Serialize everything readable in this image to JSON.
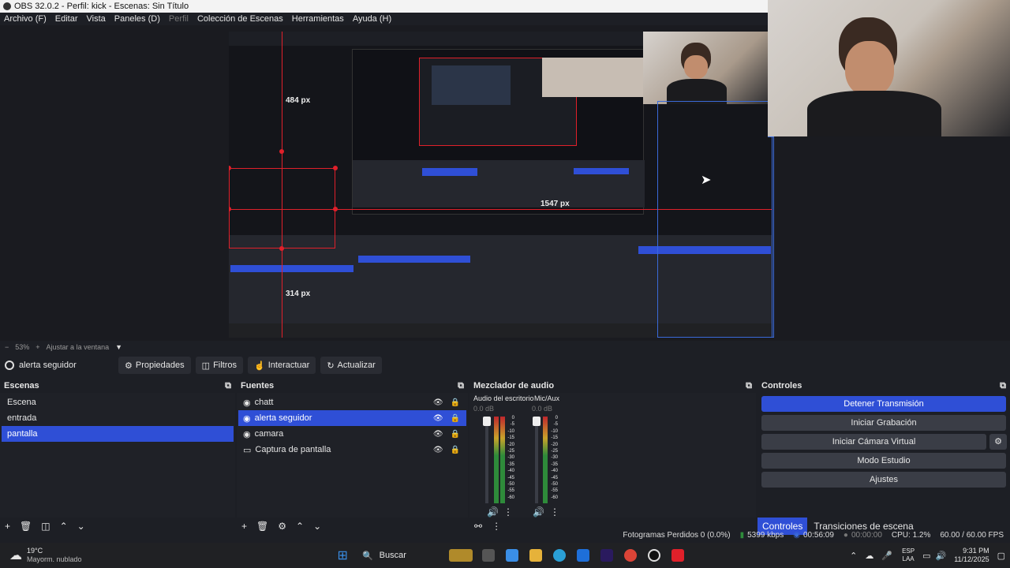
{
  "window": {
    "title": "OBS 32.0.2 - Perfil: kick - Escenas: Sin Título"
  },
  "menu": [
    "Archivo (F)",
    "Editar",
    "Vista",
    "Paneles (D)",
    "Perfil",
    "Colección de Escenas",
    "Herramientas",
    "Ayuda (H)"
  ],
  "preview": {
    "label_484": "484 px",
    "label_314": "314 px",
    "label_1547": "1547 px"
  },
  "zoom": {
    "minus": "−",
    "value": "53%",
    "plus": "+",
    "fit": "Ajustar a la ventana",
    "arrow": "▼"
  },
  "source_toolbar": {
    "selected_source": "alerta seguidor",
    "properties": "Propiedades",
    "filters": "Filtros",
    "interact": "Interactuar",
    "refresh": "Actualizar"
  },
  "scenes": {
    "title": "Escenas",
    "items": [
      "Escena",
      "entrada",
      "pantalla"
    ],
    "selected": "pantalla"
  },
  "sources": {
    "title": "Fuentes",
    "items": [
      "chatt",
      "alerta seguidor",
      "camara",
      "Captura de pantalla"
    ],
    "selected": "alerta seguidor"
  },
  "mixer": {
    "title": "Mezclador de audio",
    "channels": [
      {
        "name": "Audio del escritorio",
        "db": "0.0 dB"
      },
      {
        "name": "Mic/Aux",
        "db": "0.0 dB"
      }
    ],
    "scale": [
      "0",
      "-5",
      "-10",
      "-15",
      "-20",
      "-25",
      "-30",
      "-35",
      "-40",
      "-45",
      "-50",
      "-55",
      "-60"
    ]
  },
  "controls": {
    "title": "Controles",
    "buttons": [
      "Detener Transmisión",
      "Iniciar Grabación",
      "Iniciar Cámara Virtual",
      "Modo Estudio",
      "Ajustes"
    ],
    "tabs": [
      "Controles",
      "Transiciones de escena"
    ]
  },
  "status": {
    "dropped": "Fotogramas Perdidos 0 (0.0%)",
    "bitrate": "5399 kbps",
    "stream_time": "00:56:09",
    "rec_time": "00:00:00",
    "cpu": "CPU: 1.2%",
    "fps": "60.00 / 60.00 FPS"
  },
  "taskbar": {
    "weather_temp": "19°C",
    "weather_desc": "Mayorm. nublado",
    "search": "Buscar",
    "lang": "ESP",
    "lang2": "LAA",
    "time": "9:31 PM",
    "date": "11/12/2025"
  },
  "colors": {
    "accent": "#2f4fd6",
    "red_guides": "#e0202a",
    "blue_guides": "#3a6ad9"
  }
}
